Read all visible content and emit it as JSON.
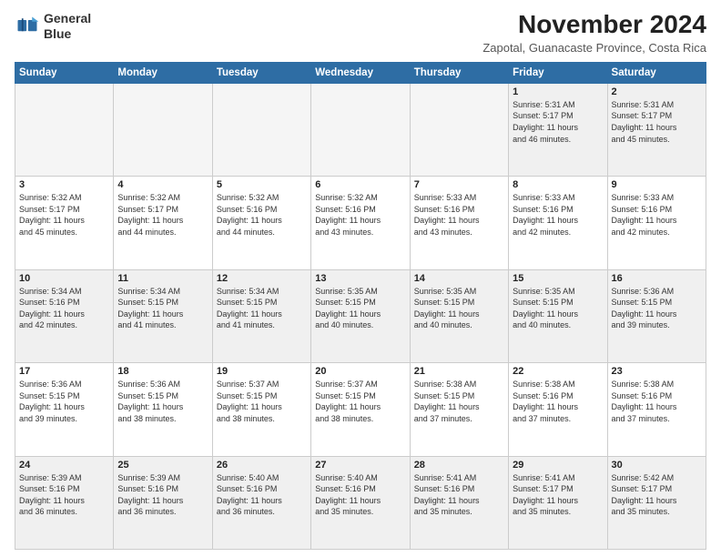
{
  "header": {
    "logo_line1": "General",
    "logo_line2": "Blue",
    "month_year": "November 2024",
    "location": "Zapotal, Guanacaste Province, Costa Rica"
  },
  "weekdays": [
    "Sunday",
    "Monday",
    "Tuesday",
    "Wednesday",
    "Thursday",
    "Friday",
    "Saturday"
  ],
  "weeks": [
    [
      {
        "day": "",
        "info": "",
        "empty": true
      },
      {
        "day": "",
        "info": "",
        "empty": true
      },
      {
        "day": "",
        "info": "",
        "empty": true
      },
      {
        "day": "",
        "info": "",
        "empty": true
      },
      {
        "day": "",
        "info": "",
        "empty": true
      },
      {
        "day": "1",
        "info": "Sunrise: 5:31 AM\nSunset: 5:17 PM\nDaylight: 11 hours\nand 46 minutes."
      },
      {
        "day": "2",
        "info": "Sunrise: 5:31 AM\nSunset: 5:17 PM\nDaylight: 11 hours\nand 45 minutes."
      }
    ],
    [
      {
        "day": "3",
        "info": "Sunrise: 5:32 AM\nSunset: 5:17 PM\nDaylight: 11 hours\nand 45 minutes."
      },
      {
        "day": "4",
        "info": "Sunrise: 5:32 AM\nSunset: 5:17 PM\nDaylight: 11 hours\nand 44 minutes."
      },
      {
        "day": "5",
        "info": "Sunrise: 5:32 AM\nSunset: 5:16 PM\nDaylight: 11 hours\nand 44 minutes."
      },
      {
        "day": "6",
        "info": "Sunrise: 5:32 AM\nSunset: 5:16 PM\nDaylight: 11 hours\nand 43 minutes."
      },
      {
        "day": "7",
        "info": "Sunrise: 5:33 AM\nSunset: 5:16 PM\nDaylight: 11 hours\nand 43 minutes."
      },
      {
        "day": "8",
        "info": "Sunrise: 5:33 AM\nSunset: 5:16 PM\nDaylight: 11 hours\nand 42 minutes."
      },
      {
        "day": "9",
        "info": "Sunrise: 5:33 AM\nSunset: 5:16 PM\nDaylight: 11 hours\nand 42 minutes."
      }
    ],
    [
      {
        "day": "10",
        "info": "Sunrise: 5:34 AM\nSunset: 5:16 PM\nDaylight: 11 hours\nand 42 minutes."
      },
      {
        "day": "11",
        "info": "Sunrise: 5:34 AM\nSunset: 5:15 PM\nDaylight: 11 hours\nand 41 minutes."
      },
      {
        "day": "12",
        "info": "Sunrise: 5:34 AM\nSunset: 5:15 PM\nDaylight: 11 hours\nand 41 minutes."
      },
      {
        "day": "13",
        "info": "Sunrise: 5:35 AM\nSunset: 5:15 PM\nDaylight: 11 hours\nand 40 minutes."
      },
      {
        "day": "14",
        "info": "Sunrise: 5:35 AM\nSunset: 5:15 PM\nDaylight: 11 hours\nand 40 minutes."
      },
      {
        "day": "15",
        "info": "Sunrise: 5:35 AM\nSunset: 5:15 PM\nDaylight: 11 hours\nand 40 minutes."
      },
      {
        "day": "16",
        "info": "Sunrise: 5:36 AM\nSunset: 5:15 PM\nDaylight: 11 hours\nand 39 minutes."
      }
    ],
    [
      {
        "day": "17",
        "info": "Sunrise: 5:36 AM\nSunset: 5:15 PM\nDaylight: 11 hours\nand 39 minutes."
      },
      {
        "day": "18",
        "info": "Sunrise: 5:36 AM\nSunset: 5:15 PM\nDaylight: 11 hours\nand 38 minutes."
      },
      {
        "day": "19",
        "info": "Sunrise: 5:37 AM\nSunset: 5:15 PM\nDaylight: 11 hours\nand 38 minutes."
      },
      {
        "day": "20",
        "info": "Sunrise: 5:37 AM\nSunset: 5:15 PM\nDaylight: 11 hours\nand 38 minutes."
      },
      {
        "day": "21",
        "info": "Sunrise: 5:38 AM\nSunset: 5:15 PM\nDaylight: 11 hours\nand 37 minutes."
      },
      {
        "day": "22",
        "info": "Sunrise: 5:38 AM\nSunset: 5:16 PM\nDaylight: 11 hours\nand 37 minutes."
      },
      {
        "day": "23",
        "info": "Sunrise: 5:38 AM\nSunset: 5:16 PM\nDaylight: 11 hours\nand 37 minutes."
      }
    ],
    [
      {
        "day": "24",
        "info": "Sunrise: 5:39 AM\nSunset: 5:16 PM\nDaylight: 11 hours\nand 36 minutes."
      },
      {
        "day": "25",
        "info": "Sunrise: 5:39 AM\nSunset: 5:16 PM\nDaylight: 11 hours\nand 36 minutes."
      },
      {
        "day": "26",
        "info": "Sunrise: 5:40 AM\nSunset: 5:16 PM\nDaylight: 11 hours\nand 36 minutes."
      },
      {
        "day": "27",
        "info": "Sunrise: 5:40 AM\nSunset: 5:16 PM\nDaylight: 11 hours\nand 35 minutes."
      },
      {
        "day": "28",
        "info": "Sunrise: 5:41 AM\nSunset: 5:16 PM\nDaylight: 11 hours\nand 35 minutes."
      },
      {
        "day": "29",
        "info": "Sunrise: 5:41 AM\nSunset: 5:17 PM\nDaylight: 11 hours\nand 35 minutes."
      },
      {
        "day": "30",
        "info": "Sunrise: 5:42 AM\nSunset: 5:17 PM\nDaylight: 11 hours\nand 35 minutes."
      }
    ]
  ]
}
